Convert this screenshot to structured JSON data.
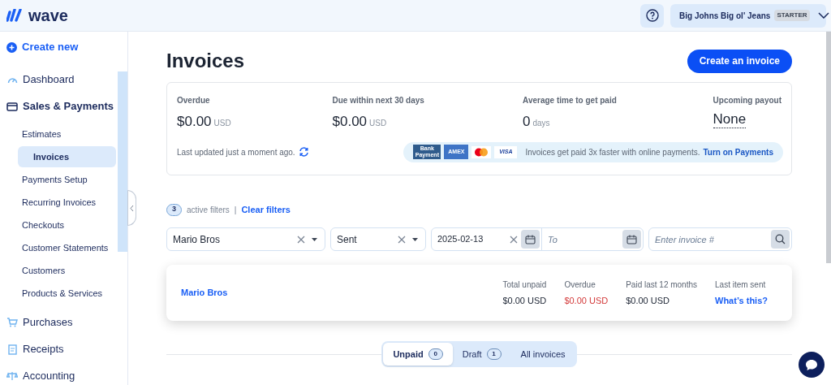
{
  "header": {
    "logo": "wave",
    "business": "Big Johns Big ol' Jeans",
    "plan": "STARTER"
  },
  "sidebar": {
    "create": "Create new",
    "items": [
      {
        "label": "Dashboard"
      },
      {
        "label": "Sales & Payments",
        "expanded": true,
        "children": [
          {
            "label": "Estimates",
            "selected": false
          },
          {
            "label": "Invoices",
            "selected": true
          },
          {
            "label": "Payments Setup",
            "selected": false
          },
          {
            "label": "Recurring Invoices",
            "selected": false
          },
          {
            "label": "Checkouts",
            "selected": false
          },
          {
            "label": "Customer Statements",
            "selected": false
          },
          {
            "label": "Customers",
            "selected": false
          },
          {
            "label": "Products & Services",
            "selected": false
          }
        ]
      },
      {
        "label": "Purchases"
      },
      {
        "label": "Receipts"
      },
      {
        "label": "Accounting"
      }
    ]
  },
  "page": {
    "title": "Invoices",
    "create_button": "Create an invoice"
  },
  "summary": {
    "stats": [
      {
        "label": "Overdue",
        "value": "$0.00",
        "unit": "USD"
      },
      {
        "label": "Due within next 30 days",
        "value": "$0.00",
        "unit": "USD"
      },
      {
        "label": "Average time to get paid",
        "value": "0",
        "unit": "days"
      },
      {
        "label": "Upcoming payout",
        "value": "None"
      }
    ],
    "updated": "Last updated just a moment ago.",
    "promo": {
      "cards": [
        {
          "kind": "bank",
          "text": "Bank Payment"
        },
        {
          "kind": "amex",
          "text": "AMEX"
        },
        {
          "kind": "mastercard"
        },
        {
          "kind": "visa",
          "text": "VISA"
        }
      ],
      "text": "Invoices get paid 3x faster with online payments.",
      "link": "Turn on Payments"
    }
  },
  "filters": {
    "count": "3",
    "label": "active filters",
    "separator": "|",
    "clear": "Clear filters",
    "customer": "Mario Bros",
    "status": "Sent",
    "from": "2025-02-13",
    "to_placeholder": "To",
    "invoice_placeholder": "Enter invoice #"
  },
  "customer_card": {
    "name": "Mario Bros",
    "stats": [
      {
        "label": "Total unpaid",
        "value": "$0.00 USD",
        "kind": "plain"
      },
      {
        "label": "Overdue",
        "value": "$0.00 USD",
        "kind": "alert"
      },
      {
        "label": "Paid last 12 months",
        "value": "$0.00 USD",
        "kind": "plain"
      },
      {
        "label": "Last item sent",
        "value": "What’s this?",
        "kind": "link"
      }
    ]
  },
  "tabs": [
    {
      "label": "Unpaid",
      "count": "0",
      "selected": true
    },
    {
      "label": "Draft",
      "count": "1",
      "selected": false
    },
    {
      "label": "All invoices",
      "selected": false
    }
  ]
}
